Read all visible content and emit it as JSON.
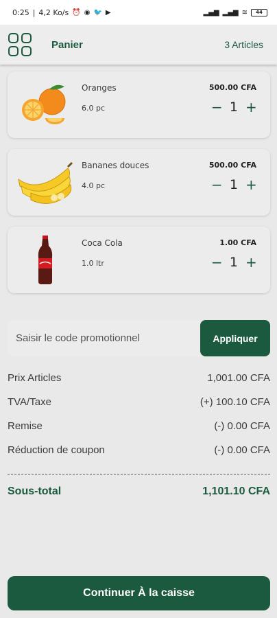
{
  "status_bar": {
    "time": "0:25",
    "speed": "4,2 Ko/s",
    "battery": "44"
  },
  "header": {
    "title": "Panier",
    "count": "3 Articles"
  },
  "cart": {
    "items": [
      {
        "name": "Oranges",
        "unit": "6.0 pc",
        "price": "500.00 CFA",
        "qty": "1",
        "image": "oranges"
      },
      {
        "name": "Bananes douces",
        "unit": "4.0 pc",
        "price": "500.00 CFA",
        "qty": "1",
        "image": "bananas"
      },
      {
        "name": "Coca Cola",
        "unit": "1.0 ltr",
        "price": "1.00 CFA",
        "qty": "1",
        "image": "coca-cola-bottle"
      }
    ],
    "minus": "−",
    "plus": "+"
  },
  "promo": {
    "placeholder": "Saisir le code promotionnel",
    "button_label": "Appliquer"
  },
  "summary": {
    "rows": [
      {
        "label": "Prix Articles",
        "value": "1,001.00 CFA"
      },
      {
        "label": "TVA/Taxe",
        "value": "(+) 100.10 CFA"
      },
      {
        "label": "Remise",
        "value": "(-) 0.00 CFA"
      },
      {
        "label": "Réduction de coupon",
        "value": "(-) 0.00 CFA"
      }
    ],
    "subtotal_label": "Sous-total",
    "subtotal_value": "1,101.10 CFA"
  },
  "checkout": {
    "label": "Continuer À la caisse"
  },
  "colors": {
    "accent": "#1c5a3f",
    "background": "#e9e9e9"
  }
}
